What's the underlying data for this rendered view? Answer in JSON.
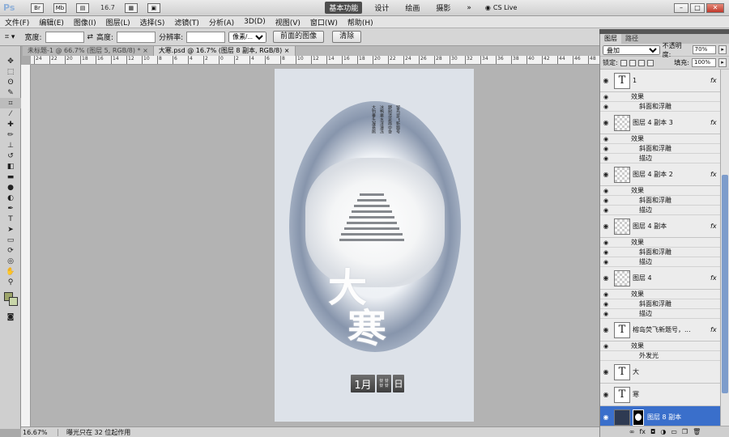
{
  "app": {
    "logo": "Ps",
    "zoom_display": "16.7"
  },
  "workspaces": [
    "基本功能",
    "设计",
    "绘画",
    "摄影"
  ],
  "more_label": "»",
  "cslive_label": "CS Live",
  "menu": [
    "文件(F)",
    "编辑(E)",
    "图像(I)",
    "图层(L)",
    "选择(S)",
    "滤镜(T)",
    "分析(A)",
    "3D(D)",
    "视图(V)",
    "窗口(W)",
    "帮助(H)"
  ],
  "options": {
    "width_label": "宽度:",
    "height_label": "高度:",
    "resolution_label": "分辨率:",
    "unit_value": "像素/...",
    "front_image_btn": "前面的图像",
    "clear_btn": "清除"
  },
  "tabs": [
    {
      "label": "未标题-1 @ 66.7% (图层 5, RGB/8) *",
      "active": false
    },
    {
      "label": "大寒.psd @ 16.7% (图层 8 副本, RGB/8)",
      "active": true
    }
  ],
  "ruler_ticks": [
    "24",
    "22",
    "20",
    "18",
    "16",
    "14",
    "12",
    "10",
    "8",
    "6",
    "4",
    "2",
    "0",
    "2",
    "4",
    "6",
    "8",
    "10",
    "12",
    "14",
    "16",
    "18",
    "20",
    "22",
    "24",
    "26",
    "28",
    "30",
    "32",
    "34",
    "36",
    "38",
    "40",
    "42",
    "44",
    "46",
    "48"
  ],
  "document": {
    "poem_columns": [
      "留鸟翠飞新题号",
      "野树清泉雨中昏",
      "冰鸭乘水浮瀑冻",
      "大钓垂头凝衰鹃"
    ],
    "title_line1": "大",
    "title_line2": "寒",
    "date_month": "1月",
    "date_middle": "廿 廿 廿 廿",
    "date_right": "日"
  },
  "status": {
    "zoom": "16.67%",
    "message": "曝光只在 32 位起作用"
  },
  "layers_panel": {
    "tab_layers": "图层",
    "tab_paths": "路径",
    "blend_mode": "叠加",
    "opacity_label": "不透明度:",
    "opacity_value": "70%",
    "lock_label": "锁定:",
    "fill_label": "填充:",
    "fill_value": "100%",
    "fx_label": "fx",
    "effects_label": "效果",
    "bevel_label": "斜面和浮雕",
    "stroke_label": "描边",
    "outer_glow_label": "外发光",
    "layers": [
      {
        "name": "1",
        "thumb": "T"
      },
      {
        "name": "图层 4 副本 3",
        "thumb": ""
      },
      {
        "name": "图层 4 副本 2",
        "thumb": ""
      },
      {
        "name": "图层 4 副本",
        "thumb": ""
      },
      {
        "name": "图层 4",
        "thumb": ""
      },
      {
        "name": "榕岛荧飞新题号，...",
        "thumb": "T"
      },
      {
        "name": "大",
        "thumb": "T"
      },
      {
        "name": "寒",
        "thumb": "T"
      },
      {
        "name": "图层 8 副本",
        "thumb": ""
      }
    ],
    "bottom_icons": [
      "∞",
      "fx",
      "◘",
      "◑",
      "▭",
      "❐",
      "🗑"
    ]
  },
  "colors": {
    "accent": "#3a6fcb",
    "foreground": "#9da56a",
    "background": "#c9d6a9"
  }
}
